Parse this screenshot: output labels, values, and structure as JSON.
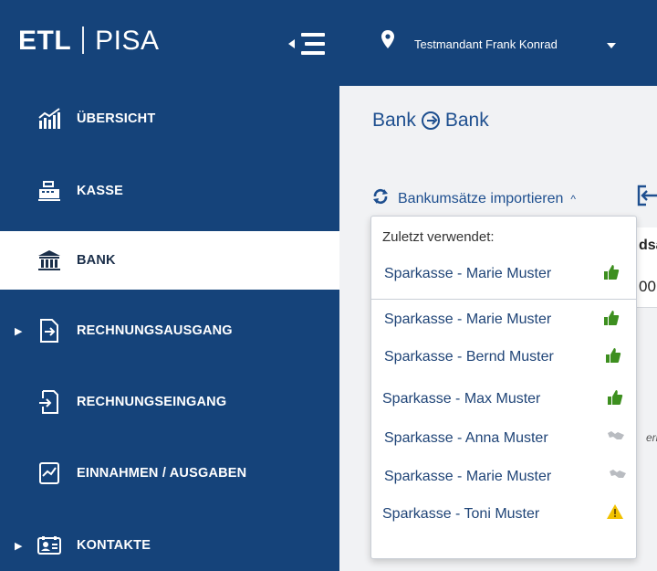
{
  "brand": {
    "left": "ETL",
    "right": "PISA"
  },
  "topbar": {
    "tenant": "Testmandant Frank Konrad"
  },
  "sidebar": {
    "items": [
      {
        "label": "ÜBERSICHT",
        "icon": "chart-icon",
        "expandable": false,
        "active": false
      },
      {
        "label": "KASSE",
        "icon": "cash-register-icon",
        "expandable": false,
        "active": false
      },
      {
        "label": "BANK",
        "icon": "bank-icon",
        "expandable": false,
        "active": true
      },
      {
        "label": "RECHNUNGSAUSGANG",
        "icon": "outgoing-invoice-icon",
        "expandable": true,
        "active": false
      },
      {
        "label": "RECHNUNGSEINGANG",
        "icon": "incoming-invoice-icon",
        "expandable": false,
        "active": false
      },
      {
        "label": "EINNAHMEN / AUSGABEN",
        "icon": "income-expense-icon",
        "expandable": false,
        "active": false
      },
      {
        "label": "KONTAKTE",
        "icon": "contacts-icon",
        "expandable": true,
        "active": false
      }
    ]
  },
  "main": {
    "breadcrumb": {
      "parent": "Bank",
      "current": "Bank"
    },
    "import_label": "Bankumsätze importieren",
    "background_fragments": {
      "col_header": "dsa",
      "value": "00",
      "note": "erk"
    }
  },
  "dropdown": {
    "recent_title": "Zuletzt verwendet:",
    "recent": [
      {
        "label": "Sparkasse - Marie Muster",
        "status": "ok"
      }
    ],
    "accounts": [
      {
        "label": "Sparkasse - Marie Muster",
        "status": "ok"
      },
      {
        "label": "Sparkasse - Bernd Muster",
        "status": "ok"
      },
      {
        "label": "Sparkasse - Max Muster",
        "status": "ok"
      },
      {
        "label": "Sparkasse - Anna Muster",
        "status": "inactive"
      },
      {
        "label": "Sparkasse - Marie Muster",
        "status": "inactive"
      },
      {
        "label": "Sparkasse - Toni Muster",
        "status": "warning"
      }
    ]
  },
  "colors": {
    "navy": "#15437a",
    "link": "#1f4477",
    "ok_green": "#3d8f1f",
    "inactive_gray": "#b9bcc1",
    "warning_yellow": "#f2c200"
  }
}
